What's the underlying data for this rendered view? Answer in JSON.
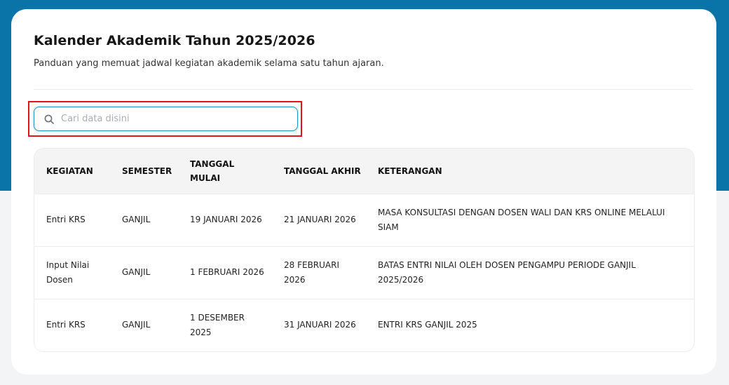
{
  "page": {
    "title": "Kalender Akademik Tahun 2025/2026",
    "subtitle": "Panduan yang memuat jadwal kegiatan akademik selama satu tahun ajaran."
  },
  "search": {
    "placeholder": "Cari data disini",
    "value": ""
  },
  "table": {
    "headers": {
      "kegiatan": "KEGIATAN",
      "semester": "SEMESTER",
      "tanggal_mulai_1": "TANGGAL",
      "tanggal_mulai_2": "MULAI",
      "tanggal_akhir": "TANGGAL AKHIR",
      "keterangan": "KETERANGAN"
    },
    "rows": [
      {
        "kegiatan_1": "Entri KRS",
        "kegiatan_2": "",
        "semester": "GANJIL",
        "mulai_1": "19 JANUARI 2026",
        "mulai_2": "",
        "akhir_1": "21 JANUARI 2026",
        "akhir_2": "",
        "ket_1": "MASA KONSULTASI DENGAN DOSEN WALI DAN KRS ONLINE MELALUI",
        "ket_2": "SIAM"
      },
      {
        "kegiatan_1": "Input Nilai",
        "kegiatan_2": "Dosen",
        "semester": "GANJIL",
        "mulai_1": "1 FEBRUARI 2026",
        "mulai_2": "",
        "akhir_1": "28 FEBRUARI",
        "akhir_2": "2026",
        "ket_1": "BATAS ENTRI NILAI OLEH DOSEN PENGAMPU PERIODE GANJIL",
        "ket_2": "2025/2026"
      },
      {
        "kegiatan_1": "Entri KRS",
        "kegiatan_2": "",
        "semester": "GANJIL",
        "mulai_1": "1 DESEMBER",
        "mulai_2": "2025",
        "akhir_1": "31 JANUARI 2026",
        "akhir_2": "",
        "ket_1": "ENTRI KRS GANJIL 2025",
        "ket_2": ""
      }
    ]
  },
  "icons": {
    "search": "search-icon"
  },
  "colors": {
    "header_band": "#0a74a8",
    "focus_border": "#1e90c7",
    "highlight_box": "#e01515"
  }
}
